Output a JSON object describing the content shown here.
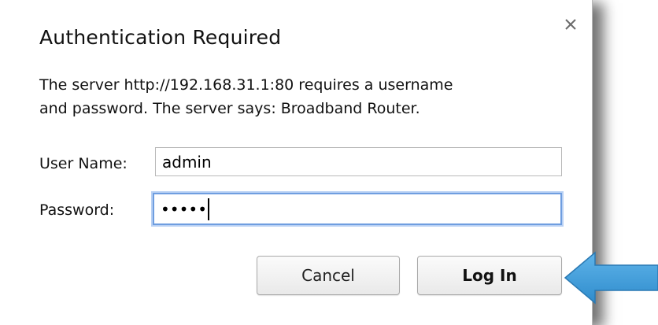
{
  "dialog": {
    "title": "Authentication Required",
    "message_line1": "The server http://192.168.31.1:80 requires a username",
    "message_line2": "and password. The server says: Broadband Router.",
    "close_glyph": "×"
  },
  "form": {
    "username_label": "User Name:",
    "username_value": "admin",
    "password_label": "Password:",
    "password_masked": "•••••"
  },
  "buttons": {
    "cancel_label": "Cancel",
    "login_label": "Log In"
  },
  "annotation": {
    "arrow_color": "#3d9ad6",
    "arrow_stroke": "#2a79b3",
    "points_to": "login-button"
  },
  "icons": {
    "close": "close-icon",
    "arrow": "pointer-arrow"
  }
}
